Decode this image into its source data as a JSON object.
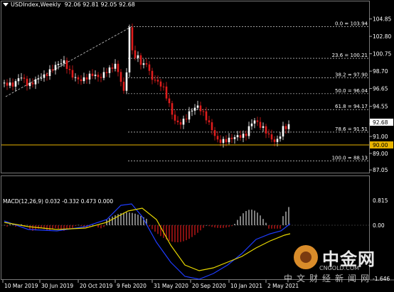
{
  "header": {
    "symbol": "USDIndex,Weekly",
    "ohlc": "92.06 92.81 92.05 92.68"
  },
  "macd_header": "MACD(12,26,9) 0.032 -0.332 0.473 0.000",
  "price_axis": {
    "labels": [
      "104.85",
      "102.80",
      "100.75",
      "98.70",
      "96.65",
      "94.55",
      "92.50",
      "91.00",
      "89.00",
      "87.05"
    ],
    "current_price": "92.68",
    "hline_price": "90.00"
  },
  "macd_axis": {
    "labels": [
      "0.815",
      "0.00",
      "-1.646"
    ]
  },
  "fib_levels": [
    {
      "label": "0.0 = 103.94",
      "value": 103.94
    },
    {
      "label": "23.6 = 100.21",
      "value": 100.21
    },
    {
      "label": "38.2 = 97.90",
      "value": 97.9
    },
    {
      "label": "50.0 = 96.04",
      "value": 96.04
    },
    {
      "label": "61.8 = 94.17",
      "value": 94.17
    },
    {
      "label": "78.6 = 91.51",
      "value": 91.51
    },
    {
      "label": "100.0 = 88.13",
      "value": 88.13
    }
  ],
  "time_axis": {
    "labels": [
      "10 Mar 2019",
      "30 Jun 2019",
      "20 Oct 2019",
      "9 Feb 2020",
      "31 May 2020",
      "20 Sep 2020",
      "10 Jan 2021",
      "2 May 2021"
    ]
  },
  "colors": {
    "bull": "#ffffff",
    "bear": "#e01c1c",
    "fib": "#ffffff",
    "hline": "#e8b400",
    "macd_signal": "#e8d800",
    "macd_line": "#1e3cff",
    "macd_hist_pos": "#d0d0d0",
    "macd_hist_neg": "#e01c1c"
  },
  "logo": {
    "name": "中金网",
    "url": "CNGOLD.COM",
    "tagline": "中文财经新闻网"
  }
}
